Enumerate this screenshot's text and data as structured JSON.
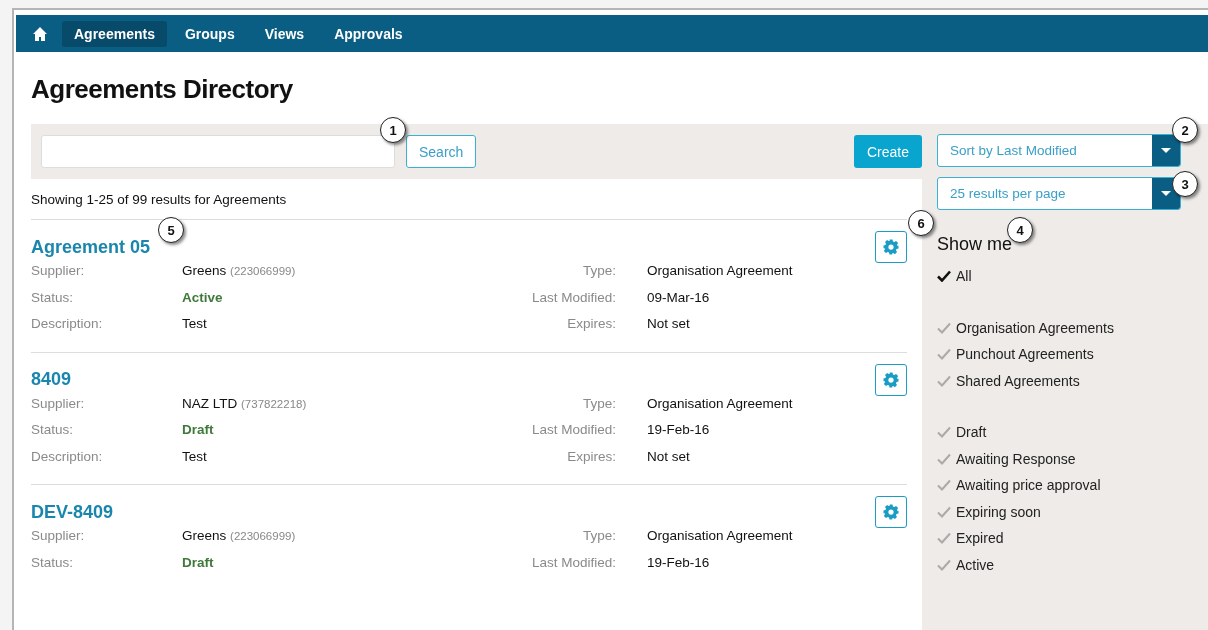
{
  "nav": {
    "items": [
      {
        "label": "Agreements",
        "selected": true
      },
      {
        "label": "Groups",
        "selected": false
      },
      {
        "label": "Views",
        "selected": false
      },
      {
        "label": "Approvals",
        "selected": false
      }
    ]
  },
  "title": "Agreements Directory",
  "search": {
    "button": "Search"
  },
  "create_button": "Create",
  "summary": "Showing 1-25 of 99 results for Agreements",
  "records": [
    {
      "title": "Agreement 05",
      "left": [
        {
          "label": "Supplier:",
          "value": "Greens",
          "code": "(223066999)",
          "kind": "text"
        },
        {
          "label": "Status:",
          "value": "Active",
          "kind": "status"
        },
        {
          "label": "Description:",
          "value": "Test",
          "kind": "text"
        }
      ],
      "right": [
        {
          "label": "Type:",
          "value": "Organisation Agreement"
        },
        {
          "label": "Last Modified:",
          "value": "09-Mar-16"
        },
        {
          "label": "Expires:",
          "value": "Not set"
        }
      ]
    },
    {
      "title": "8409",
      "left": [
        {
          "label": "Supplier:",
          "value": "NAZ LTD",
          "code": "(737822218)",
          "kind": "text"
        },
        {
          "label": "Status:",
          "value": "Draft",
          "kind": "status"
        },
        {
          "label": "Description:",
          "value": "Test",
          "kind": "text"
        }
      ],
      "right": [
        {
          "label": "Type:",
          "value": "Organisation Agreement"
        },
        {
          "label": "Last Modified:",
          "value": "19-Feb-16"
        },
        {
          "label": "Expires:",
          "value": "Not set"
        }
      ]
    },
    {
      "title": "DEV-8409",
      "left": [
        {
          "label": "Supplier:",
          "value": "Greens",
          "code": "(223066999)",
          "kind": "text"
        },
        {
          "label": "Status:",
          "value": "Draft",
          "kind": "status"
        }
      ],
      "right": [
        {
          "label": "Type:",
          "value": "Organisation Agreement"
        },
        {
          "label": "Last Modified:",
          "value": "19-Feb-16"
        }
      ]
    }
  ],
  "sort": {
    "value": "Sort by Last Modified"
  },
  "per_page": {
    "value": "25 results per page"
  },
  "filters": {
    "title": "Show me",
    "groups": [
      [
        {
          "label": "All",
          "checked": true
        }
      ],
      [
        {
          "label": "Organisation Agreements",
          "checked": false
        },
        {
          "label": "Punchout Agreements",
          "checked": false
        },
        {
          "label": "Shared Agreements",
          "checked": false
        }
      ],
      [
        {
          "label": "Draft",
          "checked": false
        },
        {
          "label": "Awaiting Response",
          "checked": false
        },
        {
          "label": "Awaiting price approval",
          "checked": false
        },
        {
          "label": "Expiring soon",
          "checked": false
        },
        {
          "label": "Expired",
          "checked": false
        },
        {
          "label": "Active",
          "checked": false
        }
      ]
    ]
  },
  "callouts": [
    "1",
    "2",
    "3",
    "4",
    "5",
    "6"
  ]
}
